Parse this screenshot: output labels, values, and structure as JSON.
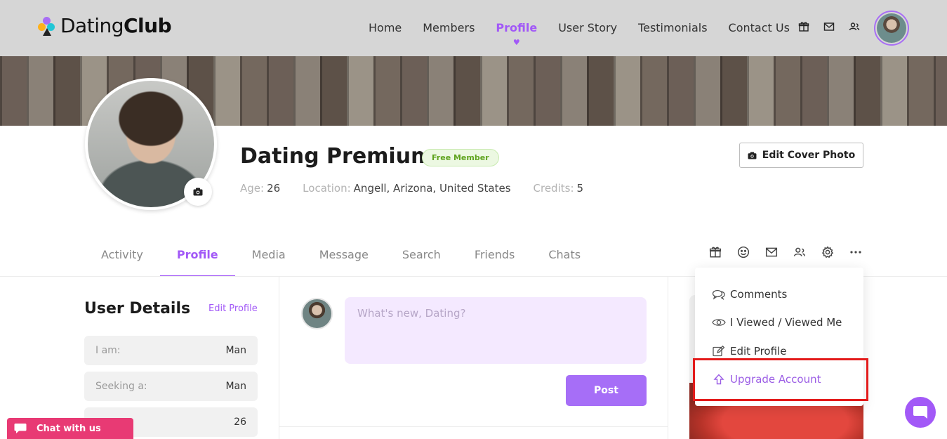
{
  "brand": {
    "name_regular": "Dating",
    "name_bold": "Club"
  },
  "nav": {
    "items": [
      "Home",
      "Members",
      "Profile",
      "User Story",
      "Testimonials",
      "Contact Us"
    ],
    "active": "Profile"
  },
  "header_icons": [
    "gift-icon",
    "mail-icon",
    "users-icon"
  ],
  "profile": {
    "name": "Dating Premium",
    "badge": "Free Member",
    "age_label": "Age:",
    "age_value": "26",
    "location_label": "Location:",
    "location_value": "Angell, Arizona, United States",
    "credits_label": "Credits:",
    "credits_value": "5",
    "edit_cover_label": "Edit Cover Photo"
  },
  "tabs": [
    "Activity",
    "Profile",
    "Media",
    "Message",
    "Search",
    "Friends",
    "Chats"
  ],
  "active_tab": "Profile",
  "tab_icons": [
    "gift-icon",
    "smile-icon",
    "mail-icon",
    "users-icon",
    "gear-icon",
    "more-icon"
  ],
  "user_details": {
    "title": "User Details",
    "edit_link": "Edit Profile",
    "rows": [
      {
        "label": "I am:",
        "value": "Man"
      },
      {
        "label": "Seeking a:",
        "value": "Man"
      },
      {
        "label": "",
        "value": "26"
      }
    ]
  },
  "post": {
    "placeholder": "What's new, Dating?",
    "button": "Post"
  },
  "dropdown": {
    "items": [
      "Comments",
      "I Viewed / Viewed Me",
      "Edit Profile",
      "Upgrade Account"
    ]
  },
  "chat": {
    "label": "Chat with us"
  },
  "colors": {
    "accent": "#a259f7",
    "badge_green": "#5fa31e",
    "chat_pink": "#e83a74",
    "highlight_red": "#e31b1b"
  }
}
